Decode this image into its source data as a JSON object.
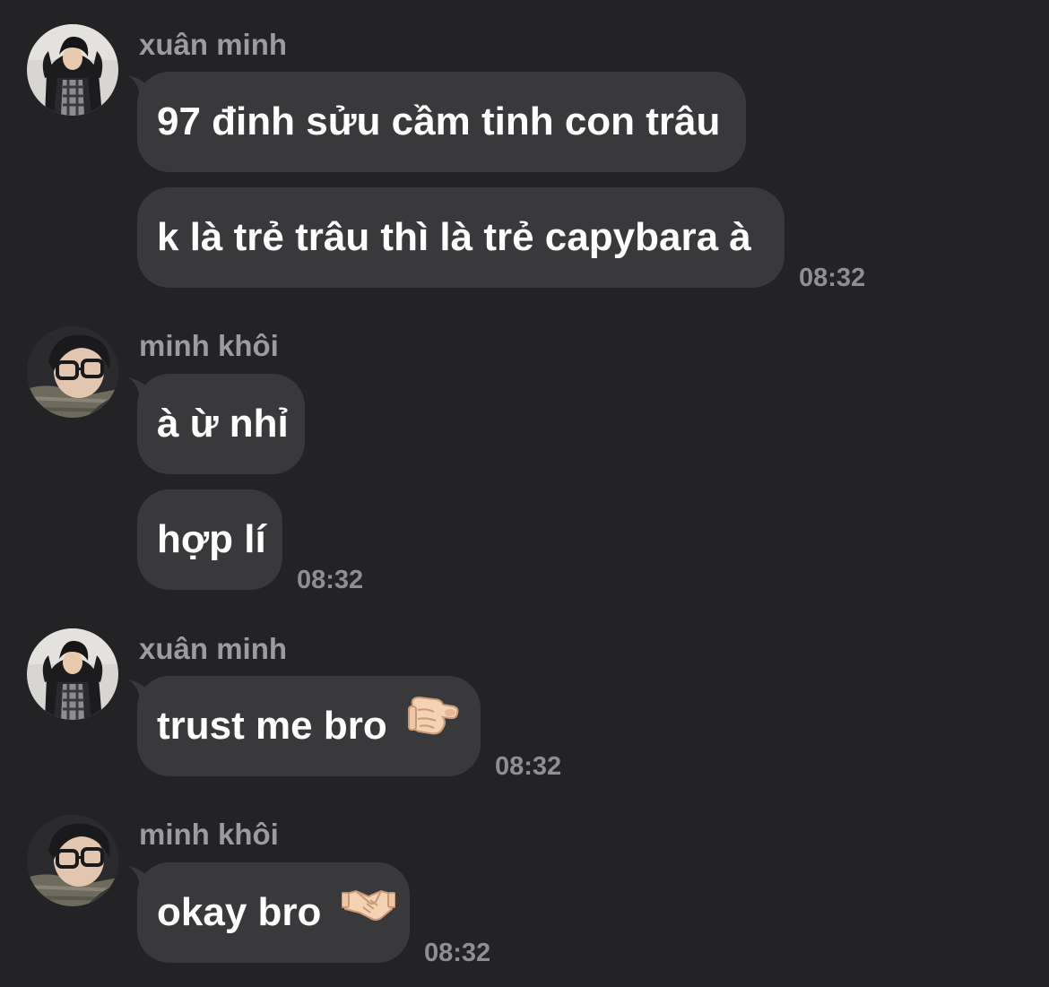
{
  "colors": {
    "background": "#232325",
    "bubble": "#39393c",
    "message_text": "#ffffff",
    "sender_name": "#9b9ba0",
    "timestamp": "#8e8e93"
  },
  "groups": [
    {
      "sender": "xuân minh",
      "avatar_icon": "avatar-photo",
      "messages": [
        "97 đinh sửu cầm tinh con trâu",
        "k là trẻ trâu thì là trẻ capybara à"
      ],
      "time": "08:32"
    },
    {
      "sender": "minh khôi",
      "avatar_icon": "avatar-photo",
      "messages": [
        "à ừ nhỉ",
        "hợp lí"
      ],
      "time": "08:32"
    },
    {
      "sender": "xuân minh",
      "avatar_icon": "avatar-photo",
      "messages": [
        "trust me bro"
      ],
      "emoji": "pointing-finger-emoji",
      "time": "08:32"
    },
    {
      "sender": "minh khôi",
      "avatar_icon": "avatar-photo",
      "messages": [
        "okay bro"
      ],
      "emoji": "handshake-emoji",
      "time": "08:32"
    }
  ]
}
